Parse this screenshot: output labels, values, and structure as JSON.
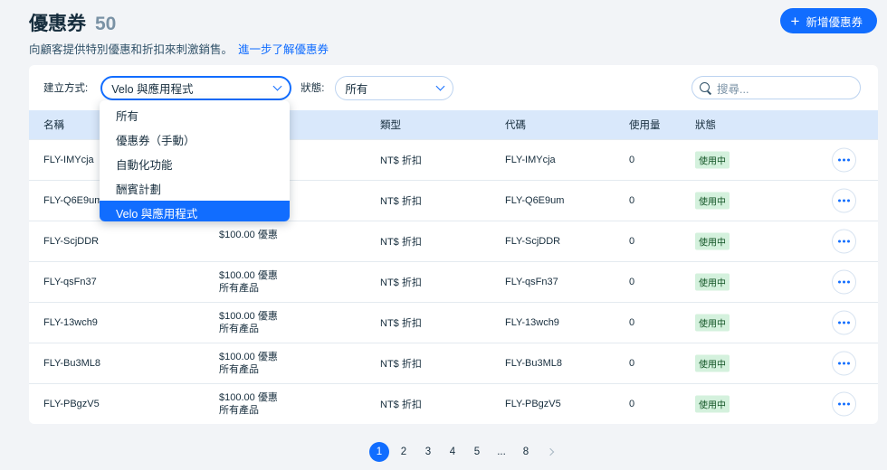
{
  "header": {
    "title": "優惠券",
    "count": "50",
    "subtitle": "向顧客提供特別優惠和折扣來刺激銷售。",
    "learn_more": "進一步了解優惠券",
    "create_button": "新增優惠券"
  },
  "filters": {
    "source_label": "建立方式:",
    "source_value": "Velo 與應用程式",
    "status_label": "狀態:",
    "status_value": "所有",
    "search_placeholder": "搜尋..."
  },
  "dropdown": {
    "options": [
      "所有",
      "優惠券（手動）",
      "自動化功能",
      "酬賓計劃",
      "Velo 與應用程式"
    ],
    "selected": "Velo 與應用程式"
  },
  "table": {
    "headers": {
      "name": "名稱",
      "type": "類型",
      "code": "代碼",
      "usage": "使用量",
      "status": "狀態"
    },
    "rows": [
      {
        "name": "FLY-IMYcja",
        "desc_line1": "",
        "desc_line2": "",
        "type": "NT$ 折扣",
        "code": "FLY-IMYcja",
        "usage": "0",
        "status": "使用中"
      },
      {
        "name": "FLY-Q6E9um",
        "desc_line1": "",
        "desc_line2": "",
        "type": "NT$ 折扣",
        "code": "FLY-Q6E9um",
        "usage": "0",
        "status": "使用中"
      },
      {
        "name": "FLY-ScjDDR",
        "desc_line1": "$100.00 優惠",
        "desc_line2": "",
        "type": "NT$ 折扣",
        "code": "FLY-ScjDDR",
        "usage": "0",
        "status": "使用中"
      },
      {
        "name": "FLY-qsFn37",
        "desc_line1": "$100.00 優惠",
        "desc_line2": "所有產品",
        "type": "NT$ 折扣",
        "code": "FLY-qsFn37",
        "usage": "0",
        "status": "使用中"
      },
      {
        "name": "FLY-13wch9",
        "desc_line1": "$100.00 優惠",
        "desc_line2": "所有產品",
        "type": "NT$ 折扣",
        "code": "FLY-13wch9",
        "usage": "0",
        "status": "使用中"
      },
      {
        "name": "FLY-Bu3ML8",
        "desc_line1": "$100.00 優惠",
        "desc_line2": "所有產品",
        "type": "NT$ 折扣",
        "code": "FLY-Bu3ML8",
        "usage": "0",
        "status": "使用中"
      },
      {
        "name": "FLY-PBgzV5",
        "desc_line1": "$100.00 優惠",
        "desc_line2": "所有產品",
        "type": "NT$ 折扣",
        "code": "FLY-PBgzV5",
        "usage": "0",
        "status": "使用中"
      }
    ]
  },
  "pagination": {
    "pages": [
      "1",
      "2",
      "3",
      "4",
      "5",
      "...",
      "8"
    ],
    "current": "1"
  },
  "colors": {
    "accent": "#116dff",
    "header_bg": "#d9e8fb",
    "badge_bg": "#d4f1dd",
    "page_bg": "#f2f4f7"
  },
  "icons": {
    "create": "plus-icon",
    "search": "search-icon",
    "select": "chevron-down-icon",
    "row_actions": "more-horizontal-icon",
    "next": "chevron-right-icon"
  }
}
